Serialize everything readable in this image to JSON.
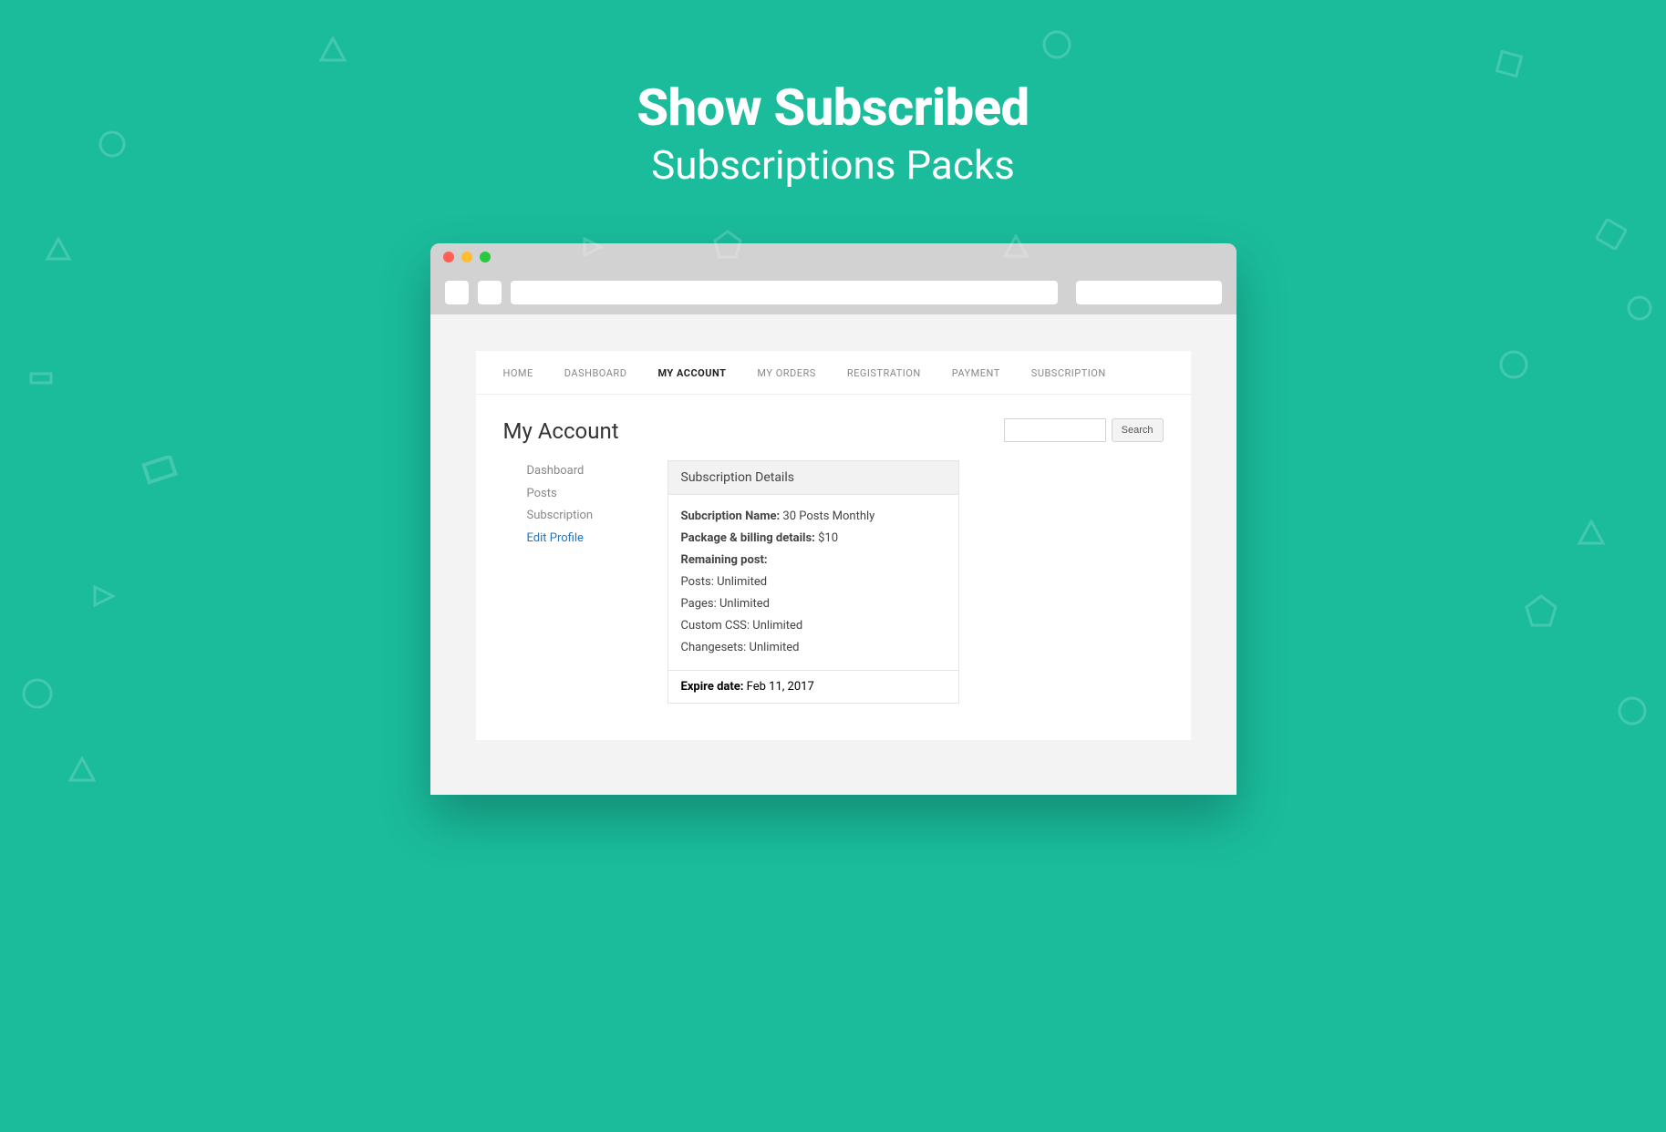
{
  "hero": {
    "title": "Show Subscribed",
    "subtitle": "Subscriptions Packs"
  },
  "nav": {
    "items": [
      {
        "label": "HOME",
        "active": false
      },
      {
        "label": "DASHBOARD",
        "active": false
      },
      {
        "label": "MY ACCOUNT",
        "active": true
      },
      {
        "label": "MY ORDERS",
        "active": false
      },
      {
        "label": "REGISTRATION",
        "active": false
      },
      {
        "label": "PAYMENT",
        "active": false
      },
      {
        "label": "SUBSCRIPTION",
        "active": false
      }
    ]
  },
  "page": {
    "heading": "My Account"
  },
  "search": {
    "button_label": "Search",
    "value": ""
  },
  "sidebar": {
    "items": [
      {
        "label": "Dashboard",
        "link": false
      },
      {
        "label": "Posts",
        "link": false
      },
      {
        "label": "Subscription",
        "link": false
      },
      {
        "label": "Edit Profile",
        "link": true
      }
    ]
  },
  "panel": {
    "header": "Subscription Details",
    "rows": [
      {
        "label": "Subcription Name:",
        "value": "30 Posts Monthly",
        "bold_label": true
      },
      {
        "label": "Package & billing details:",
        "value": "$10",
        "bold_label": true
      },
      {
        "label": "Remaining post:",
        "value": "",
        "bold_label": true
      },
      {
        "label": "Posts:",
        "value": "Unlimited",
        "bold_label": false
      },
      {
        "label": "Pages:",
        "value": "Unlimited",
        "bold_label": false
      },
      {
        "label": "Custom CSS:",
        "value": "Unlimited",
        "bold_label": false
      },
      {
        "label": "Changesets:",
        "value": "Unlimited",
        "bold_label": false
      }
    ],
    "footer": {
      "label": "Expire date:",
      "value": "Feb 11, 2017"
    }
  }
}
